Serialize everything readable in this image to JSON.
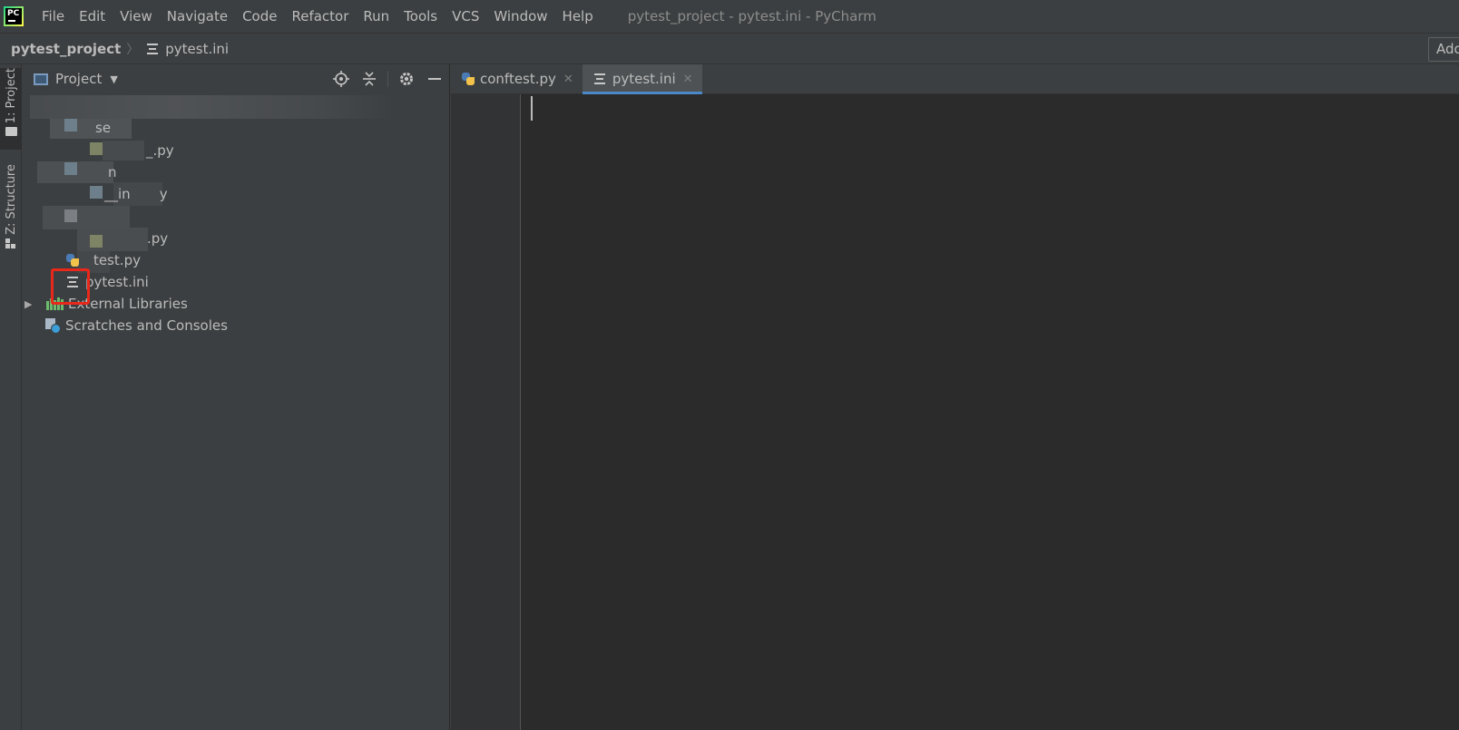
{
  "menu": {
    "items": [
      {
        "label": "File"
      },
      {
        "label": "Edit"
      },
      {
        "label": "View"
      },
      {
        "label": "Navigate"
      },
      {
        "label": "Code"
      },
      {
        "label": "Refactor"
      },
      {
        "label": "Run"
      },
      {
        "label": "Tools"
      },
      {
        "label": "VCS"
      },
      {
        "label": "Window"
      },
      {
        "label": "Help"
      }
    ],
    "logo_text": "PC"
  },
  "window_title": "pytest_project - pytest.ini - PyCharm",
  "navbar": {
    "project": "pytest_project",
    "separator": "〉",
    "file": "pytest.ini",
    "add_config_label": "Add"
  },
  "tool_stripe": {
    "project_label": "1: Project",
    "structure_label": "Z: Structure"
  },
  "project_panel": {
    "view_label": "Project",
    "tree": {
      "fragment_1": "se",
      "fragment_2": "_.py",
      "fragment_3": "n",
      "fragment_4": "__in",
      "fragment_5": "y",
      "fragment_6": ".py",
      "fragment_7": "test.py",
      "pytest_ini": "pytest.ini",
      "external_libraries": "External Libraries",
      "scratches": "Scratches and Consoles"
    }
  },
  "editor": {
    "tabs": [
      {
        "label": "conftest.py",
        "icon": "python-file-icon",
        "active": false
      },
      {
        "label": "pytest.ini",
        "icon": "ini-file-icon",
        "active": true
      }
    ]
  },
  "colors": {
    "background": "#3c3f41",
    "editor_background": "#2b2b2b",
    "active_tab_underline": "#4a88c7",
    "highlight_box": "#e8281a"
  }
}
